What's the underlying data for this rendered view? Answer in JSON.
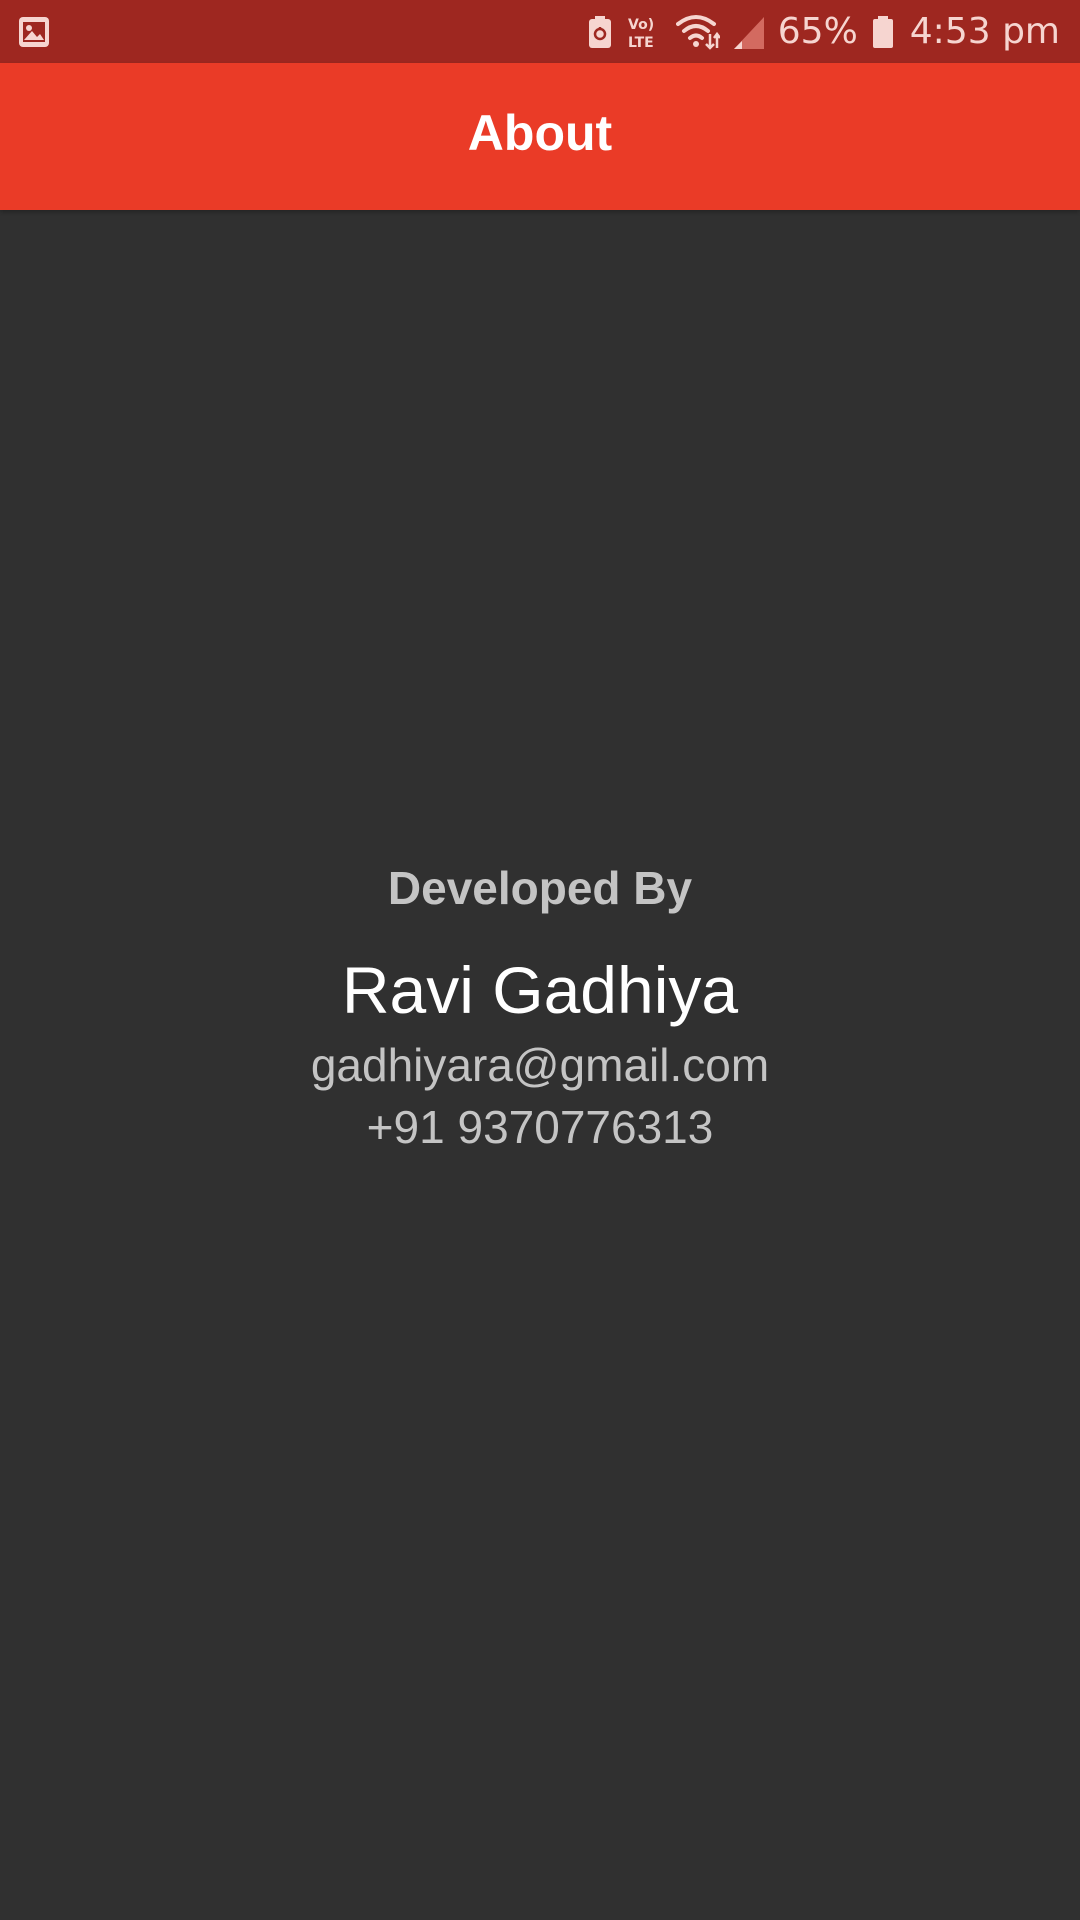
{
  "colors": {
    "status_bar": "#9e2720",
    "app_bar": "#ea3b27",
    "background": "#303030",
    "primary_text": "#ffffff",
    "secondary_text": "#c4c4c4"
  },
  "status_bar": {
    "left_icons": [
      "image-notification-icon"
    ],
    "right_icons": [
      "battery-saver-icon",
      "volte-icon",
      "wifi-icon",
      "signal-icon",
      "battery-icon"
    ],
    "volte_label": "Vo) LTE",
    "battery_percent": "65%",
    "time": "4:53 pm"
  },
  "app_bar": {
    "title": "About"
  },
  "developer": {
    "heading": "Developed By",
    "name": "Ravi Gadhiya",
    "email": "gadhiyara@gmail.com",
    "phone": "+91 9370776313"
  }
}
